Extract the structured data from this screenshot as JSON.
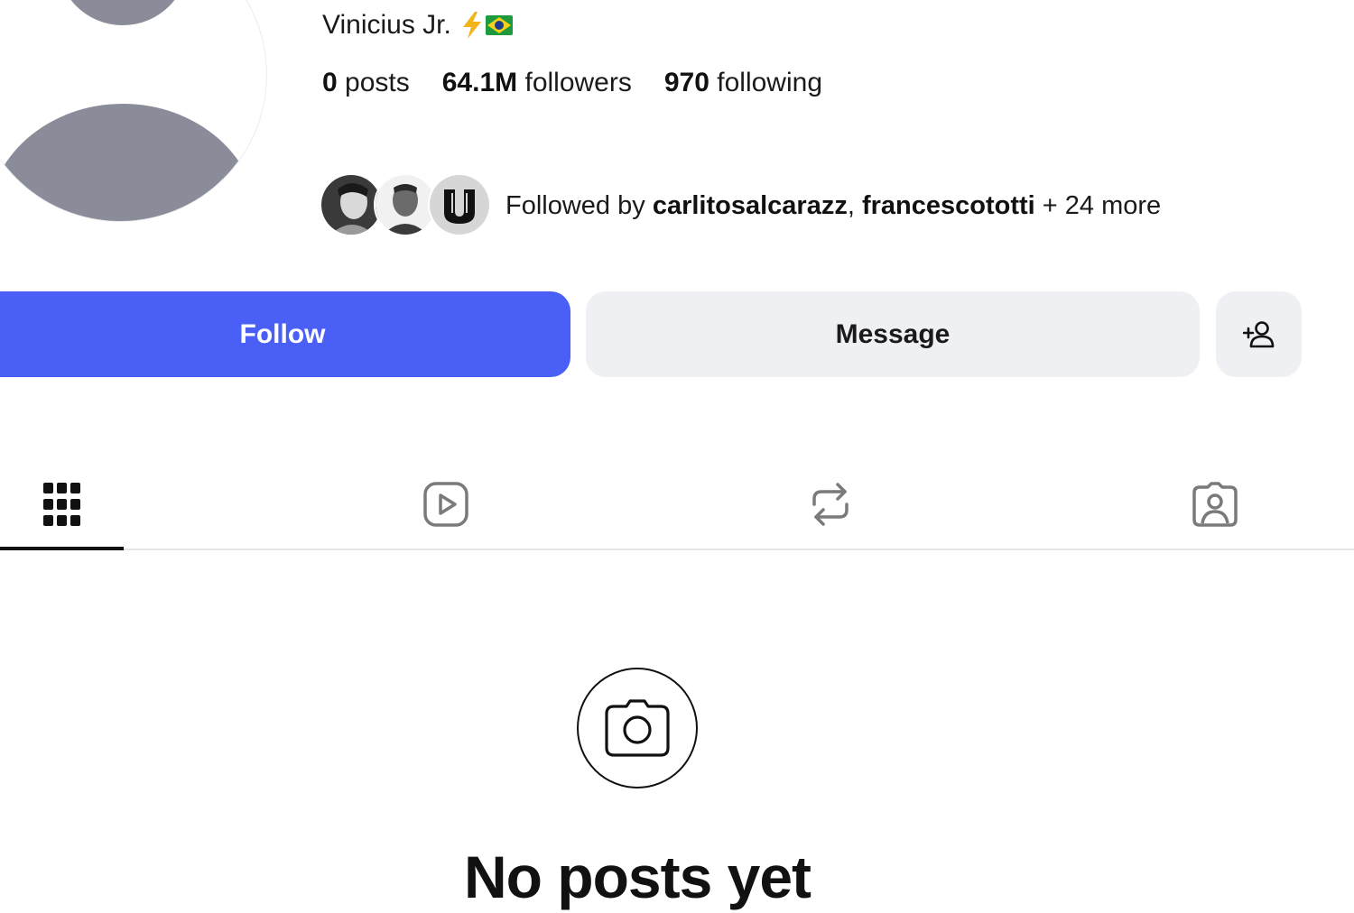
{
  "profile": {
    "display_name": "Vinicius Jr.",
    "name_emojis": [
      "lightning-icon",
      "brazil-flag-icon"
    ]
  },
  "stats": {
    "posts_count": "0",
    "posts_label": "posts",
    "followers_count": "64.1M",
    "followers_label": "followers",
    "following_count": "970",
    "following_label": "following"
  },
  "followed_by": {
    "prefix": "Followed by",
    "user1": "carlitosalcarazz",
    "separator": ",",
    "user2": "francescototti",
    "suffix": "+ 24 more"
  },
  "actions": {
    "follow_label": "Follow",
    "message_label": "Message",
    "add_user_icon": "add-person-icon"
  },
  "tabs": [
    {
      "name": "posts-grid",
      "icon": "grid-icon",
      "active": true
    },
    {
      "name": "reels",
      "icon": "reels-icon",
      "active": false
    },
    {
      "name": "reposts",
      "icon": "repost-icon",
      "active": false
    },
    {
      "name": "tagged",
      "icon": "tagged-icon",
      "active": false
    }
  ],
  "empty_state": {
    "icon": "camera-icon",
    "title": "No posts yet"
  },
  "colors": {
    "follow_button": "#4a5ff5",
    "secondary_button": "#eff0f4",
    "avatar_placeholder": "#8a8d99"
  }
}
